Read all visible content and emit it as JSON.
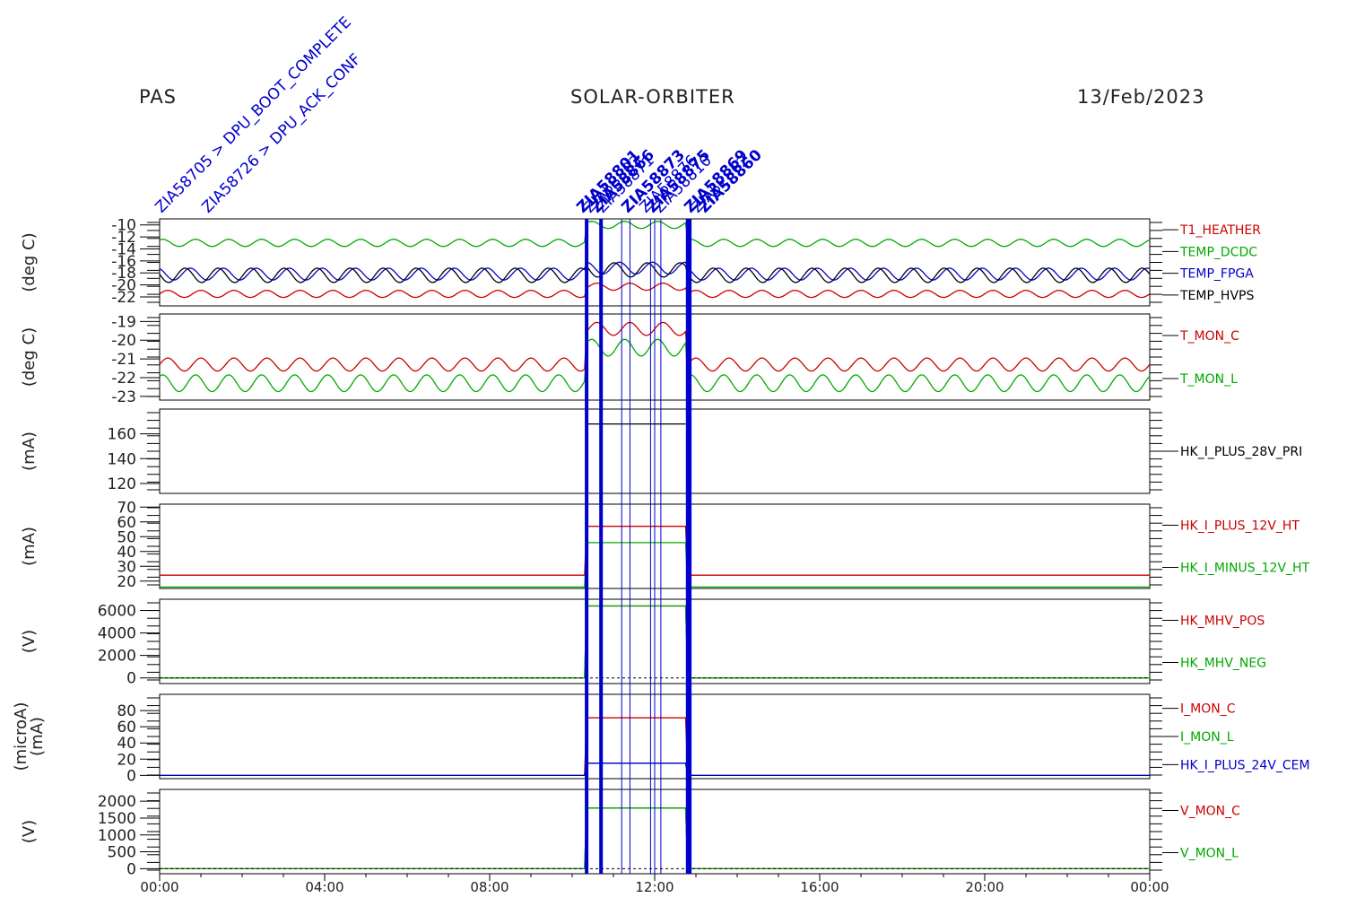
{
  "header": {
    "instrument": "PAS",
    "mission": "SOLAR-ORBITER",
    "date": "13/Feb/2023"
  },
  "colors": {
    "red": "#cc0000",
    "green": "#00aa00",
    "blue": "#0000cc",
    "black": "#000000",
    "event_blue": "#0000cc"
  },
  "chart_data": {
    "type": "line",
    "x_unit": "time of day",
    "x_range": [
      "00:00",
      "24:00"
    ],
    "x_ticks": [
      "00:00",
      "04:00",
      "08:00",
      "12:00",
      "16:00",
      "20:00",
      "00:00"
    ],
    "events": {
      "thick_lines_hours": [
        10.35,
        10.7,
        12.8,
        12.85
      ],
      "thin_lines_hours": [
        11.2,
        11.4,
        11.9,
        12.0,
        12.15
      ],
      "labels": [
        "ZIA58705 > DPU_BOOT_COMPLETE",
        "ZIA58726 > DPU_ACK_CONF",
        "ZIA58801",
        "ZIA58803",
        "ZIA58866",
        "ZIA58871",
        "ZIA58873",
        "ZIA58876",
        "ZIA58875",
        "ZIA58810",
        "ZIA58869",
        "ZIA52562",
        "ZIA58860"
      ]
    },
    "panels": [
      {
        "ylabel": "(deg C)",
        "yticks": [
          "-10",
          "-12",
          "-14",
          "-16",
          "-18",
          "-20",
          "-22"
        ],
        "ylim": [
          -23.5,
          -9
        ],
        "series": [
          {
            "name": "T1_HEATHER",
            "color": "red",
            "base": -21.5,
            "amp": 0.6,
            "on_delta": 1.2
          },
          {
            "name": "TEMP_DCDC",
            "color": "green",
            "base": -13.0,
            "amp": 0.6,
            "on_delta": 3.0
          },
          {
            "name": "TEMP_FPGA",
            "color": "blue",
            "base": -18.2,
            "amp": 1.0,
            "on_delta": 1.0
          },
          {
            "name": "TEMP_HVPS",
            "color": "black",
            "base": -18.4,
            "amp": 1.2,
            "on_delta": 0.9
          }
        ]
      },
      {
        "ylabel": "(deg C)",
        "yticks": [
          "-19",
          "-20",
          "-21",
          "-22",
          "-23"
        ],
        "ylim": [
          -23.2,
          -18.6
        ],
        "series": [
          {
            "name": "T_MON_C",
            "color": "red",
            "base": -21.3,
            "amp": 0.35,
            "on_delta": 1.9
          },
          {
            "name": "T_MON_L",
            "color": "green",
            "base": -22.3,
            "amp": 0.45,
            "on_delta": 1.9
          }
        ]
      },
      {
        "ylabel": "(mA)",
        "yticks": [
          "160",
          "140",
          "120"
        ],
        "ylim": [
          112,
          180
        ],
        "series": [
          {
            "name": "HK_I_PLUS_28V_PRI",
            "color": "black",
            "on_value": 168
          }
        ]
      },
      {
        "ylabel": "(mA)",
        "yticks": [
          "70",
          "60",
          "50",
          "40",
          "30",
          "20"
        ],
        "ylim": [
          15,
          72
        ],
        "series": [
          {
            "name": "HK_I_PLUS_12V_HT",
            "color": "red",
            "off_value": 24,
            "on_value": 57
          },
          {
            "name": "HK_I_MINUS_12V_HT",
            "color": "green",
            "off_value": 16,
            "on_value": 46
          }
        ]
      },
      {
        "ylabel": "(V)",
        "yticks": [
          "6000",
          "4000",
          "2000",
          "0"
        ],
        "ylim": [
          -500,
          7000
        ],
        "series": [
          {
            "name": "HK_MHV_POS",
            "color": "red",
            "off_value": 0,
            "on_value": 6400
          },
          {
            "name": "HK_MHV_NEG",
            "color": "green",
            "off_value": 0,
            "on_value": 6400
          }
        ]
      },
      {
        "ylabel": "(microA)\n(mA)",
        "yticks": [
          "80",
          "60",
          "40",
          "20",
          "0"
        ],
        "ylim": [
          -4,
          100
        ],
        "series": [
          {
            "name": "I_MON_C",
            "color": "red",
            "off_value": 0,
            "on_value": 71
          },
          {
            "name": "I_MON_L",
            "color": "green",
            "off_value": 0,
            "on_value": 15
          },
          {
            "name": "HK_I_PLUS_24V_CEM",
            "color": "blue",
            "off_value": 0,
            "on_value": 15
          }
        ]
      },
      {
        "ylabel": "(V)",
        "yticks": [
          "2000",
          "1500",
          "1000",
          "500",
          "0"
        ],
        "ylim": [
          -150,
          2350
        ],
        "series": [
          {
            "name": "V_MON_C",
            "color": "red",
            "off_value": 0,
            "on_value": 1800
          },
          {
            "name": "V_MON_L",
            "color": "green",
            "off_value": 0,
            "on_value": 1800
          }
        ]
      }
    ]
  }
}
